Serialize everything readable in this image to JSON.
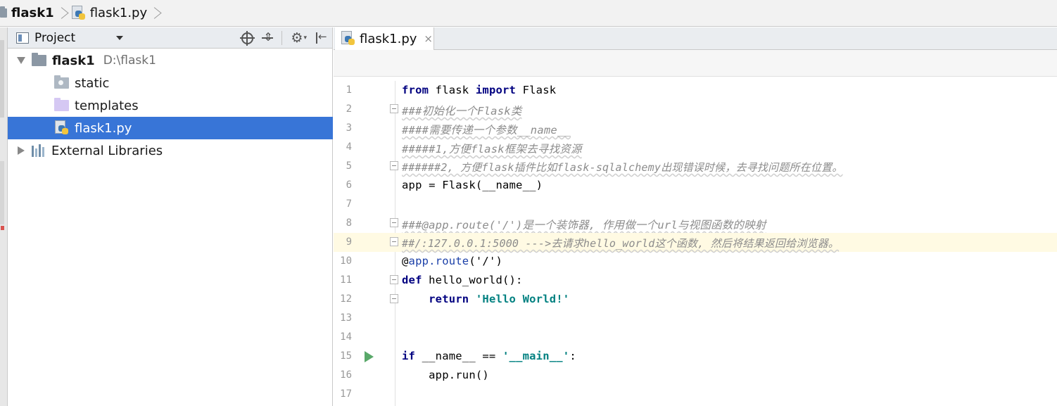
{
  "breadcrumb": {
    "project": "flask1",
    "file": "flask1.py"
  },
  "project_panel": {
    "title": "Project",
    "tree": [
      {
        "label": "flask1",
        "path": "D:\\flask1",
        "expanded": true
      },
      {
        "label": "static"
      },
      {
        "label": "templates"
      },
      {
        "label": "flask1.py",
        "selected": true
      },
      {
        "label": "External Libraries",
        "expanded": false
      }
    ]
  },
  "editor": {
    "tab_label": "flask1.py",
    "tab_close": "×",
    "current_line": 9,
    "run_line": 15,
    "lines": [
      {
        "n": "1"
      },
      {
        "n": "2",
        "text": "###初始化一个Flask类"
      },
      {
        "n": "3",
        "text": "####需要传递一个参数__name__"
      },
      {
        "n": "4",
        "text": "#####1,方便flask框架去寻找资源"
      },
      {
        "n": "5",
        "text": "######2, 方便flask插件比如flask-sqlalchemy出现错误时候，去寻找问题所在位置。"
      },
      {
        "n": "6",
        "text": "app = Flask(__name__)"
      },
      {
        "n": "7",
        "text": ""
      },
      {
        "n": "8",
        "text": "###@app.route('/')是一个装饰器, 作用做一个url与视图函数的映射"
      },
      {
        "n": "9",
        "text": "##/:127.0.0.1:5000 --->去请求hello_world这个函数, 然后将结果返回给浏览器。"
      },
      {
        "n": "10"
      },
      {
        "n": "11"
      },
      {
        "n": "12"
      },
      {
        "n": "13",
        "text": ""
      },
      {
        "n": "14",
        "text": ""
      },
      {
        "n": "15"
      },
      {
        "n": "16",
        "text": "    app.run()"
      },
      {
        "n": "17",
        "text": ""
      }
    ],
    "tokens": {
      "from": "from",
      "flask_mod": " flask ",
      "import": "import",
      "flask_cls": " Flask",
      "at": "@",
      "app_route": "app.route",
      "route_arg": "('/')",
      "def": "def",
      "func_sig": " hello_world():",
      "indent": "    ",
      "return": "return",
      "hello_str": "'Hello World!'",
      "if": "if",
      "name_cmp": " __name__ == ",
      "main_str": "'__main__'",
      "colon": ":"
    }
  },
  "colors": {
    "selection": "#3875d7",
    "keyword": "#000080",
    "comment": "#8c8c8c",
    "string": "#008080",
    "current_line": "#fffae3",
    "run_icon": "#59a869"
  }
}
